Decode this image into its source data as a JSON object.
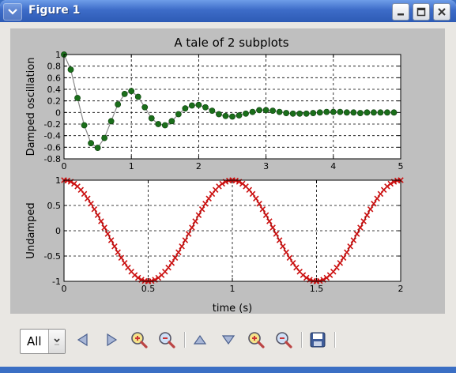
{
  "window": {
    "title": "Figure 1"
  },
  "figure": {
    "suptitle": "A tale of 2 subplots"
  },
  "chart_data": [
    {
      "type": "line",
      "title": "A tale of 2 subplots",
      "xlabel": "",
      "ylabel": "Damped oscillation",
      "xlim": [
        0,
        5
      ],
      "ylim": [
        -0.8,
        1
      ],
      "xticks": [
        "0",
        "1",
        "2",
        "3",
        "4",
        "5"
      ],
      "yticks": [
        "-0.8",
        "-0.6",
        "-0.4",
        "-0.2",
        "0",
        "0.2",
        "0.4",
        "0.6",
        "0.8",
        "1"
      ],
      "grid": true,
      "marker": "circle",
      "marker_color": "#1a6e1a",
      "line_color": "#8a8a8a",
      "series": [
        {
          "x": [
            0.0,
            0.1,
            0.2,
            0.3,
            0.4,
            0.5,
            0.6,
            0.7,
            0.8,
            0.9,
            1.0,
            1.1,
            1.2,
            1.3,
            1.4,
            1.5,
            1.6,
            1.7,
            1.8,
            1.9,
            2.0,
            2.1,
            2.2,
            2.3,
            2.4,
            2.5,
            2.6,
            2.7,
            2.8,
            2.9,
            3.0,
            3.1,
            3.2,
            3.3,
            3.4,
            3.5,
            3.6,
            3.7,
            3.8,
            3.9,
            4.0,
            4.1,
            4.2,
            4.3,
            4.4,
            4.5,
            4.6,
            4.7,
            4.8,
            4.9
          ],
          "y": [
            1.0,
            0.74,
            0.25,
            -0.22,
            -0.53,
            -0.61,
            -0.44,
            -0.15,
            0.14,
            0.32,
            0.37,
            0.27,
            0.09,
            -0.1,
            -0.2,
            -0.22,
            -0.15,
            -0.03,
            0.07,
            0.12,
            0.13,
            0.09,
            0.03,
            -0.03,
            -0.06,
            -0.07,
            -0.05,
            -0.02,
            0.01,
            0.04,
            0.04,
            0.03,
            0.01,
            -0.01,
            -0.02,
            -0.02,
            -0.02,
            -0.01,
            0.0,
            0.01,
            0.01,
            0.01,
            0.0,
            0.0,
            -0.01,
            0.0,
            0.0,
            0.0,
            0.0,
            0.0
          ]
        }
      ]
    },
    {
      "type": "line",
      "title": "",
      "xlabel": "time (s)",
      "ylabel": "Undamped",
      "xlim": [
        0,
        2
      ],
      "ylim": [
        -1,
        1
      ],
      "xticks": [
        "0",
        "0.5",
        "1",
        "1.5",
        "2"
      ],
      "yticks": [
        "-1",
        "-0.5",
        "0",
        "0.5",
        "1"
      ],
      "grid": true,
      "marker": "x",
      "marker_color": "#cc1111",
      "line_color": "#8b0000",
      "function": "cos(2*pi*t)",
      "x_step": 0.02
    }
  ],
  "toolbar": {
    "zoom_select": "All",
    "buttons": [
      {
        "name": "pan-left-button",
        "icon": "triangle-left-icon"
      },
      {
        "name": "pan-right-button",
        "icon": "triangle-right-icon"
      },
      {
        "name": "zoom-in-x-button",
        "icon": "zoom-in-icon"
      },
      {
        "name": "zoom-out-x-button",
        "icon": "zoom-out-icon"
      },
      {
        "name": "pan-up-button",
        "icon": "triangle-up-icon"
      },
      {
        "name": "pan-down-button",
        "icon": "triangle-down-icon"
      },
      {
        "name": "zoom-in-y-button",
        "icon": "zoom-in-icon"
      },
      {
        "name": "zoom-out-y-button",
        "icon": "zoom-out-icon"
      },
      {
        "name": "save-button",
        "icon": "floppy-disk-icon"
      }
    ]
  }
}
